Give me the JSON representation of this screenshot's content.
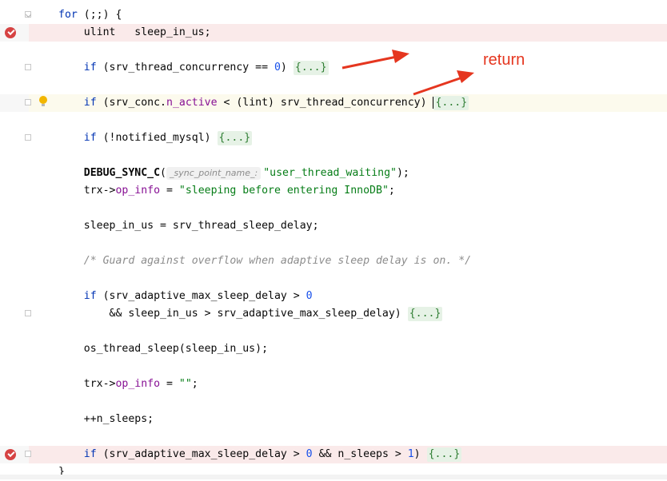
{
  "editor": {
    "lines": [
      {
        "id": "l1",
        "tokens": [
          {
            "t": "for",
            "c": "kw"
          },
          {
            "t": " (;;) {",
            "c": ""
          }
        ]
      },
      {
        "id": "l2",
        "tokens": [
          {
            "t": "    ulint   sleep_in_us;",
            "c": ""
          }
        ]
      },
      {
        "id": "l3",
        "tokens": [
          {
            "t": "    ",
            "c": ""
          },
          {
            "t": "if",
            "c": "kw"
          },
          {
            "t": " (srv_thread_concurrency == ",
            "c": ""
          },
          {
            "t": "0",
            "c": "num"
          },
          {
            "t": ") ",
            "c": ""
          },
          {
            "t": "{...}",
            "c": "fold-chip"
          }
        ]
      },
      {
        "id": "l4",
        "tokens": [
          {
            "t": "    ",
            "c": ""
          },
          {
            "t": "if",
            "c": "kw"
          },
          {
            "t": " (srv_conc.",
            "c": ""
          },
          {
            "t": "n_active",
            "c": "field"
          },
          {
            "t": " < (lint) srv_thread_concurrency) ",
            "c": ""
          },
          {
            "t": "|",
            "c": "cursor"
          },
          {
            "t": "{...}",
            "c": "fold-chip"
          }
        ]
      },
      {
        "id": "l5",
        "tokens": [
          {
            "t": "    ",
            "c": ""
          },
          {
            "t": "if",
            "c": "kw"
          },
          {
            "t": " (!notified_mysql) ",
            "c": ""
          },
          {
            "t": "{...}",
            "c": "fold-chip"
          }
        ]
      },
      {
        "id": "l6",
        "tokens": [
          {
            "t": "    ",
            "c": ""
          },
          {
            "t": "DEBUG_SYNC_C",
            "c": "bold"
          },
          {
            "t": "(",
            "c": ""
          },
          {
            "t": "_sync_point_name_:",
            "c": "hint"
          },
          {
            "t": "\"user_thread_waiting\"",
            "c": "str"
          },
          {
            "t": ");",
            "c": ""
          }
        ]
      },
      {
        "id": "l7",
        "tokens": [
          {
            "t": "    trx->",
            "c": ""
          },
          {
            "t": "op_info",
            "c": "field"
          },
          {
            "t": " = ",
            "c": ""
          },
          {
            "t": "\"sleeping before entering InnoDB\"",
            "c": "str"
          },
          {
            "t": ";",
            "c": ""
          }
        ]
      },
      {
        "id": "l8",
        "tokens": [
          {
            "t": "    sleep_in_us = srv_thread_sleep_delay;",
            "c": ""
          }
        ]
      },
      {
        "id": "l9",
        "tokens": [
          {
            "t": "    ",
            "c": ""
          },
          {
            "t": "/* Guard against overflow when adaptive sleep delay is on. */",
            "c": "cmt"
          }
        ]
      },
      {
        "id": "l10",
        "tokens": [
          {
            "t": "    ",
            "c": ""
          },
          {
            "t": "if",
            "c": "kw"
          },
          {
            "t": " (srv_adaptive_max_sleep_delay > ",
            "c": ""
          },
          {
            "t": "0",
            "c": "num"
          }
        ]
      },
      {
        "id": "l11",
        "tokens": [
          {
            "t": "        && sleep_in_us > srv_adaptive_max_sleep_delay) ",
            "c": ""
          },
          {
            "t": "{...}",
            "c": "fold-chip"
          }
        ]
      },
      {
        "id": "l12",
        "tokens": [
          {
            "t": "    os_thread_sleep(sleep_in_us);",
            "c": ""
          }
        ]
      },
      {
        "id": "l13",
        "tokens": [
          {
            "t": "    trx->",
            "c": ""
          },
          {
            "t": "op_info",
            "c": "field"
          },
          {
            "t": " = ",
            "c": ""
          },
          {
            "t": "\"\"",
            "c": "str"
          },
          {
            "t": ";",
            "c": ""
          }
        ]
      },
      {
        "id": "l14",
        "tokens": [
          {
            "t": "    ++n_sleeps;",
            "c": ""
          }
        ]
      },
      {
        "id": "l15",
        "tokens": [
          {
            "t": "    ",
            "c": ""
          },
          {
            "t": "if",
            "c": "kw"
          },
          {
            "t": " (srv_adaptive_max_sleep_delay > ",
            "c": ""
          },
          {
            "t": "0",
            "c": "num"
          },
          {
            "t": " && n_sleeps > ",
            "c": ""
          },
          {
            "t": "1",
            "c": "num"
          },
          {
            "t": ") ",
            "c": ""
          },
          {
            "t": "{...}",
            "c": "fold-chip"
          }
        ]
      },
      {
        "id": "l16",
        "tokens": [
          {
            "t": "}",
            "c": ""
          }
        ]
      }
    ]
  },
  "annotation": {
    "label": "return",
    "color": "#e5361f"
  },
  "colors": {
    "breakpoint_line": "#faeaea",
    "caret_line": "#fcfaed",
    "keyword": "#0033b3",
    "string": "#067d17",
    "field": "#871094"
  }
}
